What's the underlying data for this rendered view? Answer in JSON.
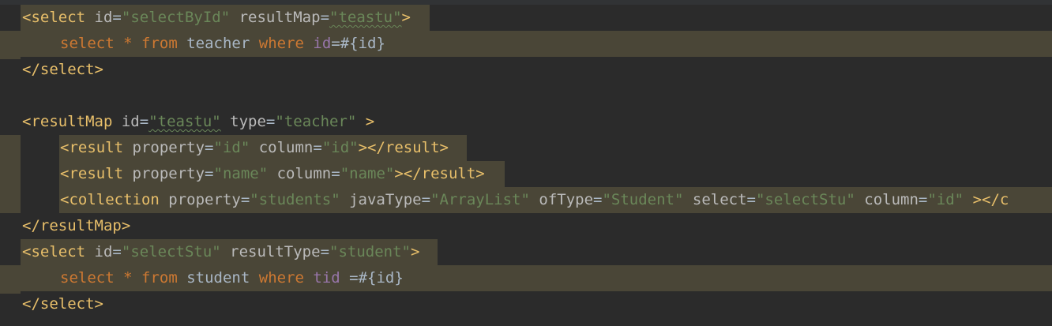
{
  "code": {
    "select1": {
      "open_tag": "<select",
      "id_attr": "id",
      "id_val": "\"selectById\"",
      "rm_attr": "resultMap",
      "rm_val": "\"teastu\"",
      "close_bracket": ">",
      "sql_select": "select",
      "sql_star": "*",
      "sql_from": "from",
      "sql_table": "teacher",
      "sql_where": "where",
      "sql_field": "id",
      "sql_rest": "=#{id}",
      "end_tag": "</select>"
    },
    "resultmap": {
      "open_tag": "<resultMap",
      "id_attr": "id",
      "id_val": "\"teastu\"",
      "type_attr": "type",
      "type_val": "\"teacher\"",
      "close_bracket": " >",
      "end_tag": "</resultMap>",
      "result1": {
        "open_tag": "<result",
        "prop_attr": "property",
        "prop_val": "\"id\"",
        "col_attr": "column",
        "col_val": "\"id\"",
        "close": "></result>"
      },
      "result2": {
        "open_tag": "<result",
        "prop_attr": "property",
        "prop_val": "\"name\"",
        "col_attr": "column",
        "col_val": "\"name\"",
        "close": "></result>"
      },
      "collection": {
        "open_tag": "<collection",
        "prop_attr": "property",
        "prop_val": "\"students\"",
        "jt_attr": "javaType",
        "jt_val": "\"ArrayList\"",
        "of_attr": "ofType",
        "of_val": "\"Student\"",
        "sel_attr": "select",
        "sel_val": "\"selectStu\"",
        "col_attr": "column",
        "col_val": "\"id\"",
        "close": " ></c"
      }
    },
    "select2": {
      "open_tag": "<select",
      "id_attr": "id",
      "id_val": "\"selectStu\"",
      "rt_attr": "resultType",
      "rt_val": "\"student\"",
      "close_bracket": ">",
      "sql_select": "select",
      "sql_star": "*",
      "sql_from": "from",
      "sql_table": "student",
      "sql_where": "where",
      "sql_field": "tid",
      "sql_rest": " =#{id}",
      "end_tag": "</select>"
    }
  },
  "colors": {
    "background": "#2b2b2b",
    "highlight": "#4a4637",
    "tag": "#e8bf6a",
    "attribute": "#bababa",
    "string": "#6a8759",
    "keyword": "#cc7832",
    "field": "#9876aa",
    "text": "#a9b7c6"
  }
}
